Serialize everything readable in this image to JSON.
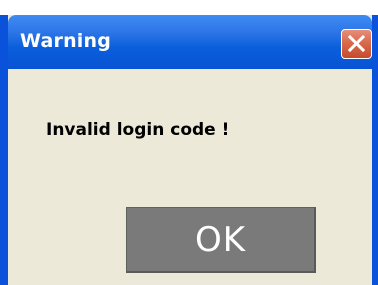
{
  "dialog": {
    "title": "Warning",
    "message": "Invalid login code !",
    "ok_label": "OK"
  },
  "icons": {
    "close": "close-icon"
  },
  "colors": {
    "titlebar": "#0a5fdc",
    "close_button": "#d86a4d",
    "body": "#ece9d8",
    "ok_button": "#7a7a7a"
  }
}
